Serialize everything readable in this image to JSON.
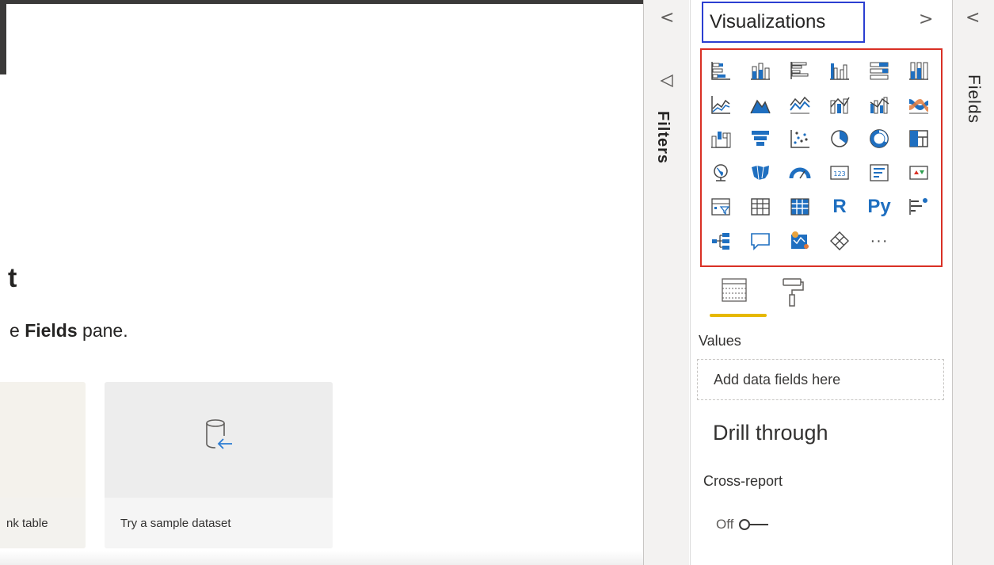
{
  "canvas": {
    "title": "t",
    "subtitle_prefix": "e ",
    "subtitle_bold": "Fields",
    "subtitle_suffix": " pane.",
    "cards": [
      {
        "label": "nk table"
      },
      {
        "label": "Try a sample dataset"
      }
    ]
  },
  "filters": {
    "collapse_glyph": "<",
    "label": "Filters"
  },
  "visualizations": {
    "title": "Visualizations",
    "expand_glyph": ">",
    "r_visual_label": "R",
    "python_visual_label": "Py",
    "more_label": "···",
    "values_label": "Values",
    "add_fields_placeholder": "Add data fields here",
    "drill_through_title": "Drill through",
    "cross_report_label": "Cross-report",
    "toggle_state": "Off"
  },
  "fields": {
    "collapse_glyph": "<",
    "label": "Fields"
  },
  "colors": {
    "title_box_border": "#2b3fd1",
    "grid_border": "#d93025",
    "accent_blue": "#1f6fc0",
    "tab_underline": "#e6b800"
  }
}
